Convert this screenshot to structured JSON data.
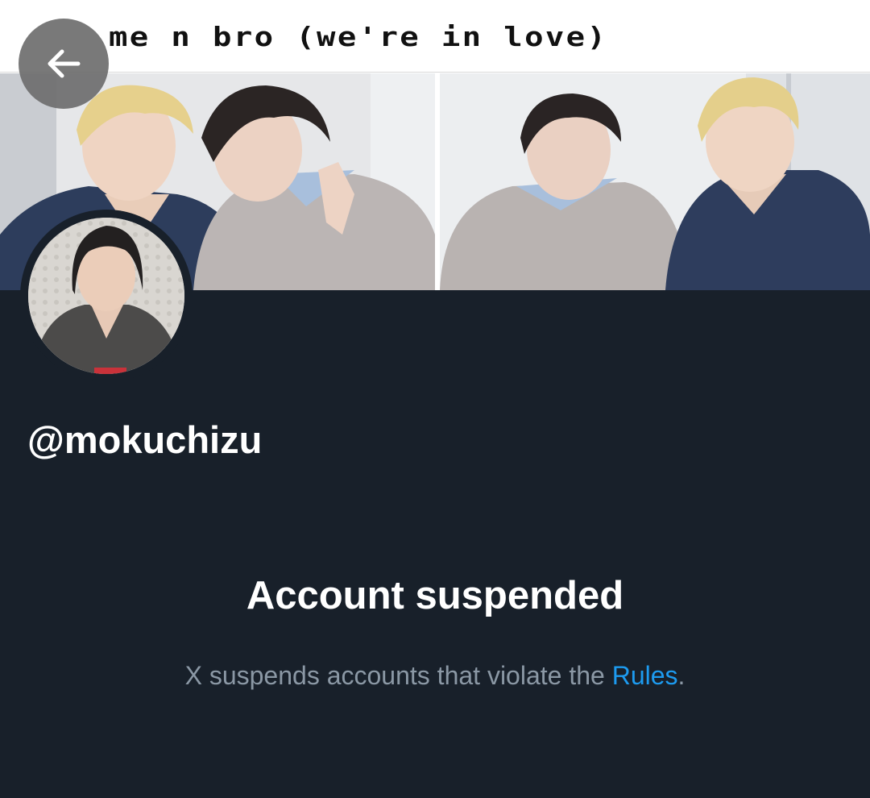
{
  "banner": {
    "caption": "me n bro (we're in love)"
  },
  "back_button": {
    "icon": "arrow-left-icon"
  },
  "profile": {
    "handle": "@mokuchizu"
  },
  "suspension": {
    "title": "Account suspended",
    "message_prefix": "X suspends accounts that violate the ",
    "rules_link": "Rules",
    "message_suffix": "."
  },
  "colors": {
    "background": "#18202a",
    "link": "#1d9bf0",
    "muted_text": "#8b98a5"
  }
}
